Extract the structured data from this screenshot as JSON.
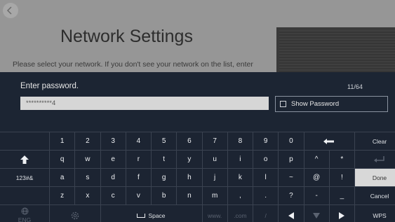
{
  "background": {
    "title": "Network Settings",
    "description": "Please select your network. If you don't see your network on the list, enter"
  },
  "password": {
    "label": "Enter password.",
    "counter": "11/64",
    "value": "**********4",
    "show_password_label": "Show Password"
  },
  "keyboard": {
    "row1": [
      "1",
      "2",
      "3",
      "4",
      "5",
      "6",
      "7",
      "8",
      "9",
      "0"
    ],
    "row1_right": "Clear",
    "row2": [
      "q",
      "w",
      "e",
      "r",
      "t",
      "y",
      "u",
      "i",
      "o",
      "p",
      "^",
      "*"
    ],
    "row3_left": "123#&",
    "row3": [
      "a",
      "s",
      "d",
      "f",
      "g",
      "h",
      "j",
      "k",
      "l",
      "~",
      "@",
      "!"
    ],
    "row3_right": "Done",
    "row4": [
      "z",
      "x",
      "c",
      "v",
      "b",
      "n",
      "m",
      ",",
      ".",
      "?",
      "-",
      "_"
    ],
    "row4_right": "Cancel",
    "row5_left": "ENG",
    "space": "Space",
    "www": "www.",
    "com": ".com",
    "slash": "/",
    "row5_right": "WPS"
  }
}
